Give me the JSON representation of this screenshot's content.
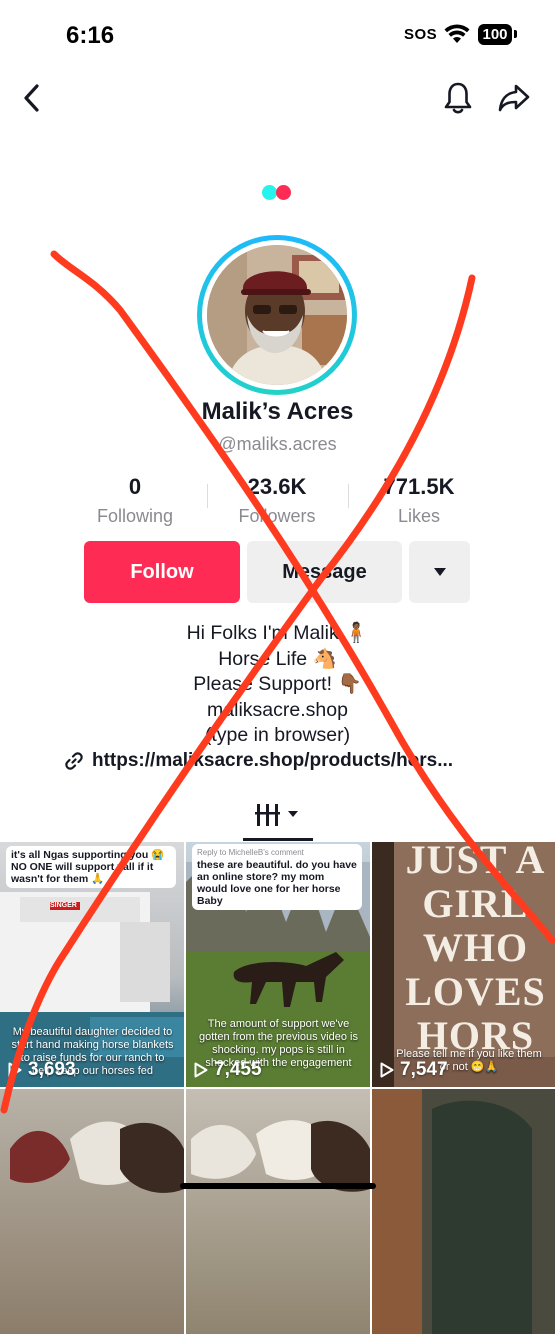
{
  "status_bar": {
    "time": "6:16",
    "sos": "SOS",
    "battery": "100",
    "wifi_icon": "wifi-icon"
  },
  "nav": {
    "back_icon": "chevron-left-icon",
    "bell_icon": "bell-icon",
    "share_icon": "share-arrow-icon"
  },
  "profile": {
    "name": "Malik’s Acres",
    "handle": "@maliks.acres",
    "stats": [
      {
        "num": "0",
        "label": "Following"
      },
      {
        "num": "23.6K",
        "label": "Followers"
      },
      {
        "num": "771.5K",
        "label": "Likes"
      }
    ],
    "buttons": {
      "follow": "Follow",
      "message": "Message",
      "more_icon": "caret-down-icon"
    },
    "bio": {
      "line1": "Hi Folks I'm Malik",
      "line2": "Horse Life",
      "line3": "Please Support!",
      "line4": "maliksacre.shop",
      "line5": "(type in browser)"
    },
    "link": "https://maliksacre.shop/products/hors..."
  },
  "tabs": {
    "grid_icon": "video-grid-icon"
  },
  "videos": [
    {
      "views": "3,693",
      "caption": "it's all Ngas supporting you 😭 NO ONE will support yall if it wasn't for them 🙏",
      "overlay": "My beautiful daughter decided to start hand making horse blankets to raise funds for our ranch to help keep our horses fed",
      "sign": "SINGER"
    },
    {
      "views": "7,455",
      "caption": "these are beautiful. do you have an online store? my mom would love one for her horse Baby",
      "reply": "Reply to MichelleB's comment",
      "overlay": "The amount of support we've gotten from the previous video is shocking. my pops is still in shocked with the engagement"
    },
    {
      "views": "7,547",
      "overlay": "Please tell me if you like them or not 😁🙏",
      "blanket_text": "JUST A GIRL WHO LOVES HORS"
    },
    {
      "views": ""
    },
    {
      "views": ""
    },
    {
      "views": ""
    }
  ],
  "colors": {
    "accent": "#fe2c55",
    "cross": "#ff3b1f",
    "ring": "#1eb8ff",
    "loader_cyan": "#25f4ee",
    "loader_red": "#fe2c55"
  }
}
